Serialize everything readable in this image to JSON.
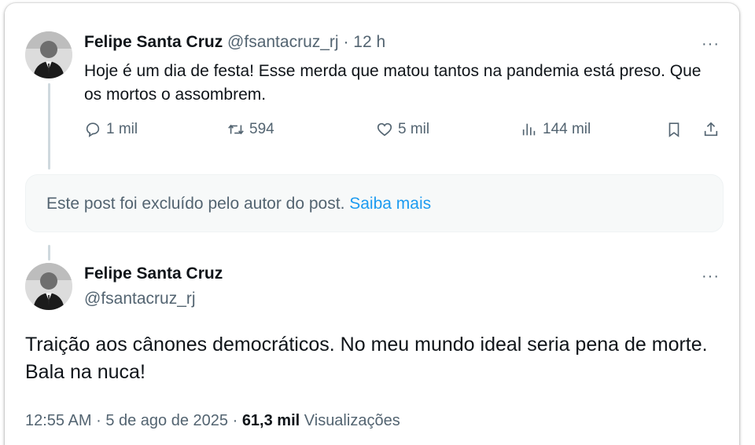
{
  "tweet1": {
    "author_name": "Felipe Santa Cruz",
    "handle": "@fsantacruz_rj",
    "separator": "·",
    "time": "12 h",
    "more": "···",
    "text": "Hoje é um dia de festa! Esse merda que matou tantos na pandemia está preso. Que os mortos o assombrem.",
    "actions": {
      "replies": "1 mil",
      "reposts": "594",
      "likes": "5 mil",
      "views": "144 mil"
    }
  },
  "deleted_notice": {
    "text": "Este post foi excluído pelo autor do post.",
    "link": "Saiba mais"
  },
  "tweet2": {
    "author_name": "Felipe Santa Cruz",
    "handle": "@fsantacruz_rj",
    "more": "···",
    "text": "Traição aos cânones democráticos. No meu mundo ideal seria pena de morte. Bala na nuca!",
    "time": "12:55 AM",
    "separator": "·",
    "date": "5 de ago de 2025",
    "views_count": "61,3 mil",
    "views_label": "Visualizações"
  },
  "icons": {
    "reply": "reply-icon",
    "repost": "repost-icon",
    "like": "heart-icon",
    "views": "bar-chart-icon",
    "bookmark": "bookmark-icon",
    "share": "share-icon"
  },
  "colors": {
    "text": "#0f1419",
    "muted": "#536471",
    "link": "#1d9bf0",
    "thread_line": "#cfd9de",
    "deleted_bg": "#f7f9f9"
  }
}
